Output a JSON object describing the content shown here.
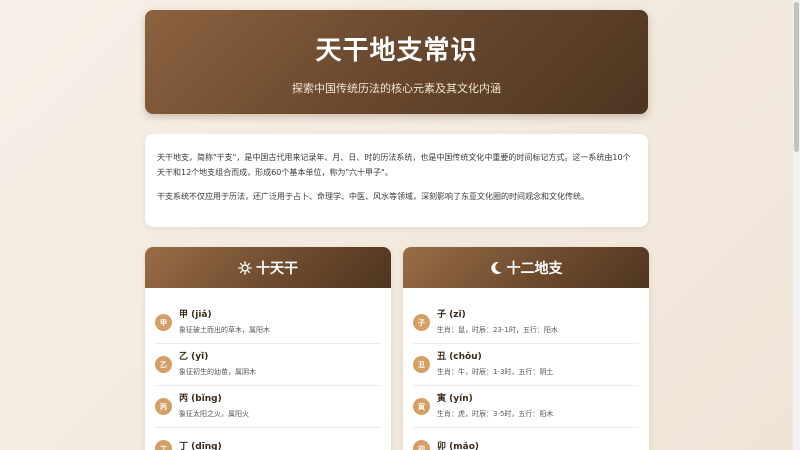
{
  "header": {
    "title": "天干地支常识",
    "subtitle": "探索中国传统历法的核心元素及其文化内涵"
  },
  "intro": {
    "paragraphs": [
      "天干地支，简称\"干支\"，是中国古代用来记录年、月、日、时的历法系统，也是中国传统文化中重要的时间标记方式。这一系统由10个天干和12个地支组合而成，形成60个基本单位，称为\"六十甲子\"。",
      "干支系统不仅应用于历法，还广泛用于占卜、命理学、中医、风水等领域，深刻影响了东亚文化圈的时间观念和文化传统。"
    ]
  },
  "tiangan": {
    "title": "十天干",
    "icon": "sun-icon",
    "items": [
      {
        "char": "甲",
        "name": "甲 (jiǎ)",
        "desc": "象征破土而出的草木，属阳木"
      },
      {
        "char": "乙",
        "name": "乙 (yǐ)",
        "desc": "象征初生的幼苗，属阴木"
      },
      {
        "char": "丙",
        "name": "丙 (bǐng)",
        "desc": "象征太阳之火，属阳火"
      },
      {
        "char": "丁",
        "name": "丁 (dīng)",
        "desc": ""
      }
    ]
  },
  "dizhi": {
    "title": "十二地支",
    "icon": "moon-icon",
    "items": [
      {
        "char": "子",
        "name": "子 (zǐ)",
        "desc": "生肖：鼠，时辰：23-1时，五行：阳水"
      },
      {
        "char": "丑",
        "name": "丑 (chǒu)",
        "desc": "生肖：牛，时辰：1-3时，五行：阴土"
      },
      {
        "char": "寅",
        "name": "寅 (yín)",
        "desc": "生肖：虎，时辰：3-5时，五行：阳木"
      },
      {
        "char": "卯",
        "name": "卯 (mǎo)",
        "desc": ""
      }
    ]
  },
  "colors": {
    "accent": "#d5a067",
    "header_dark": "#4e3520",
    "header_light": "#8c6240"
  }
}
